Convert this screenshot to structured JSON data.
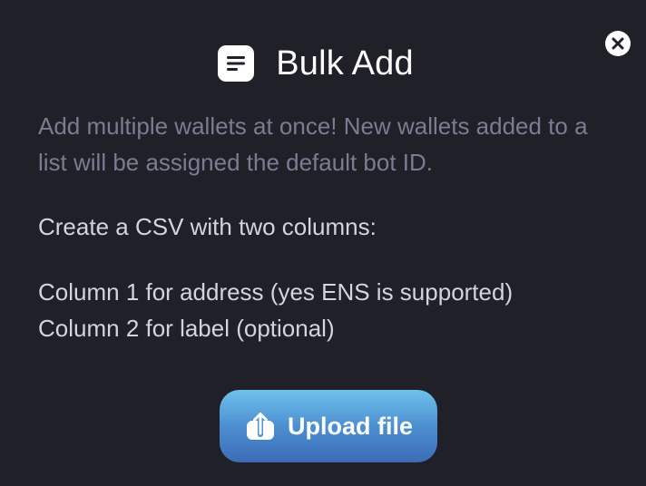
{
  "dialog": {
    "title": "Bulk Add",
    "header_icon": "document-lines-icon",
    "close_icon": "close-icon",
    "description": "Add multiple wallets at once! New wallets added to a list will be assigned the default bot ID.",
    "instructions": [
      "Create a CSV with two columns:",
      "Column 1 for address (yes ENS is supported)",
      "Column 2 for label (optional)"
    ],
    "upload_button": {
      "label": "Upload file",
      "icon": "upload-icon"
    }
  },
  "colors": {
    "background": "#1f2028",
    "title": "#ffffff",
    "description": "#7a7d92",
    "instructions": "#d4d5dc",
    "button_top": "#6ec2ec",
    "button_bottom": "#3c6cb6"
  }
}
